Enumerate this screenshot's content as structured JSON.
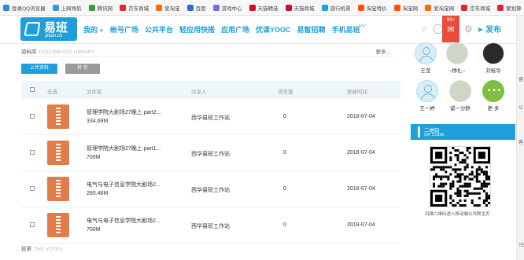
{
  "bookmarks": [
    {
      "label": "登录QQ浏览器",
      "color": "#3a85d8"
    },
    {
      "label": "上网导航",
      "color": "#2f9be8"
    },
    {
      "label": "腾讯网",
      "color": "#3a9b3a"
    },
    {
      "label": "京东商城",
      "color": "#d92b2b"
    },
    {
      "label": "爱淘宝",
      "color": "#ff6a00"
    },
    {
      "label": "百度",
      "color": "#3168d6"
    },
    {
      "label": "游戏中心",
      "color": "#7a6fd1"
    },
    {
      "label": "天猫精选",
      "color": "#c8102e"
    },
    {
      "label": "天猫商城",
      "color": "#c8102e"
    },
    {
      "label": "旅行机票",
      "color": "#1ba0e1"
    },
    {
      "label": "淘宝特价",
      "color": "#ff5000"
    },
    {
      "label": "淘宝网",
      "color": "#ff5000"
    },
    {
      "label": "爱淘宝网",
      "color": "#ff6a00"
    },
    {
      "label": "京东商城",
      "color": "#d92b2b"
    },
    {
      "label": "聚划算",
      "color": "#d92b2b"
    }
  ],
  "logo": {
    "name": "易班",
    "domain": "yiban.cn"
  },
  "nav": {
    "items": [
      {
        "label": "我的",
        "caret": "▼"
      },
      {
        "label": "帐号广场"
      },
      {
        "label": "公共平台"
      },
      {
        "label": "轻应用快搭"
      },
      {
        "label": "应用广场"
      },
      {
        "label": "优课YOOC"
      },
      {
        "label": "易智招聘"
      },
      {
        "label": "手机易班"
      }
    ],
    "mail_count": "99+",
    "publish": "发布"
  },
  "documents": {
    "title": "资料库",
    "title_en": "DOCUMENTS LIBRARY",
    "more": "更多...",
    "upload": "上传资料",
    "transfer": "转 存",
    "columns": {
      "select_all": "全选",
      "name": "文件名",
      "sharer": "共享人",
      "views": "浏览量",
      "time": "更新时间"
    },
    "rows": [
      {
        "name": "管理学院大剧场27晚上.part2...",
        "size": "334.69M",
        "sharer": "西华易班工作站",
        "views": "0",
        "time": "2018-07-04"
      },
      {
        "name": "管理学院大剧场27晚上.part1...",
        "size": "700M",
        "sharer": "西华易班工作站",
        "views": "0",
        "time": "2018-07-04"
      },
      {
        "name": "电气与电子信息学院大剧场2...",
        "size": "280.46M",
        "sharer": "西华易班工作站",
        "views": "0",
        "time": "2018-07-04"
      },
      {
        "name": "电气与电子信息学院大剧场2...",
        "size": "700M",
        "sharer": "西华易班工作站",
        "views": "0",
        "time": "2018-07-04"
      }
    ]
  },
  "votes": {
    "title": "投票",
    "title_en": "THE VOTES"
  },
  "members": [
    {
      "name": "王莹"
    },
    {
      "name": "~挣扎~"
    },
    {
      "name": "刘桂华"
    },
    {
      "name": "王一婷"
    },
    {
      "name": "留一分醉"
    },
    {
      "name": "更 多"
    }
  ],
  "qr": {
    "title": "二维码",
    "title_en": "QR CODE",
    "caption": "扫描二维码进入移动端公共群主页"
  },
  "edge_labels": [
    "留",
    "公",
    "客",
    "TE"
  ]
}
